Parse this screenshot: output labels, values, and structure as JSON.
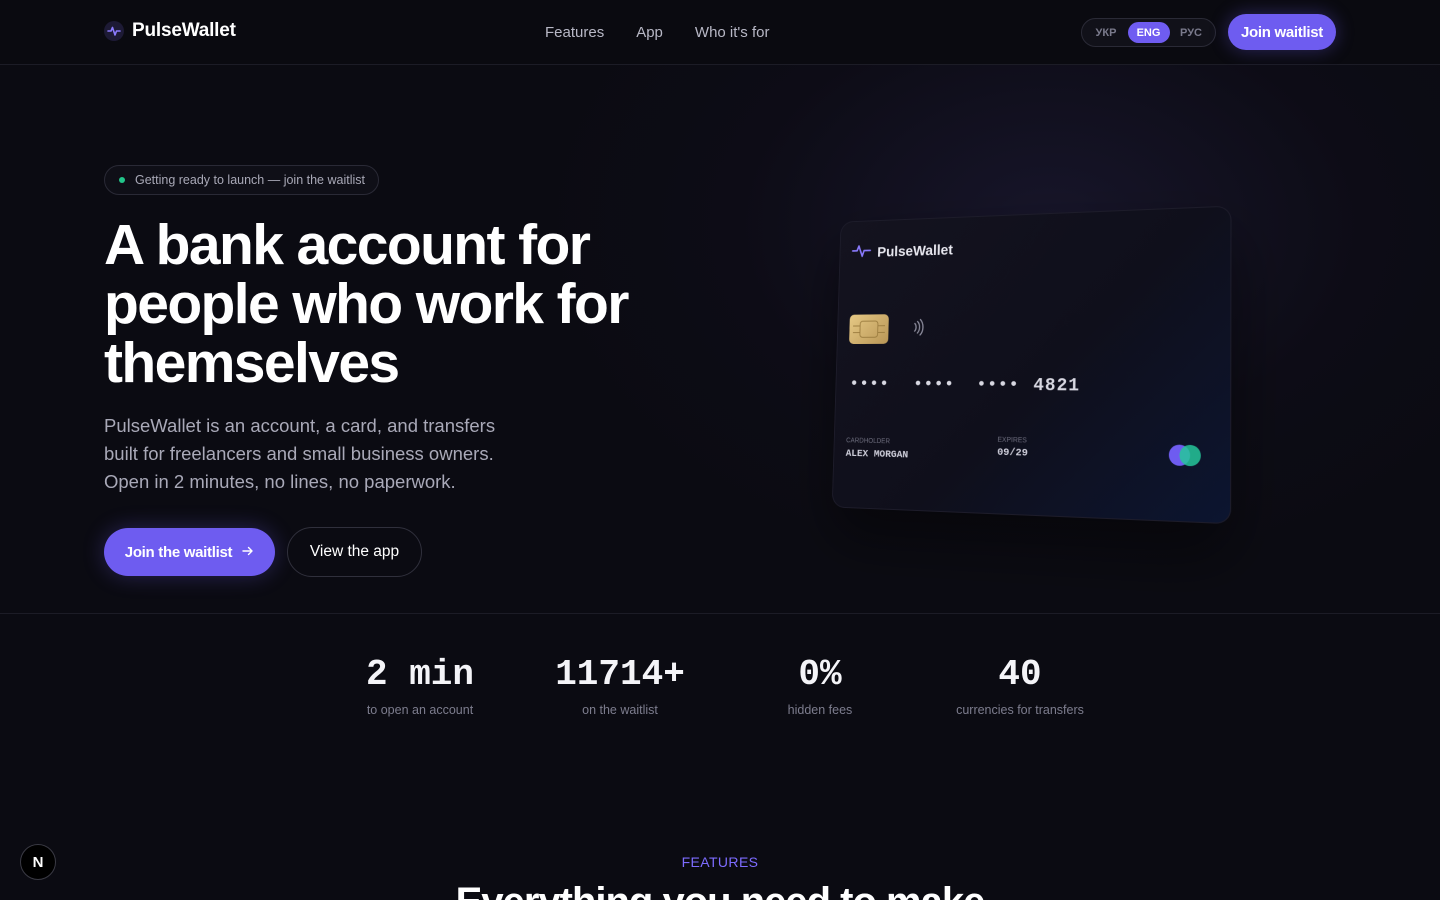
{
  "header": {
    "logo_text": "PulseWallet",
    "logo_icon": "pulse-icon",
    "nav": [
      "Features",
      "App",
      "Who it's for"
    ],
    "languages": [
      "УКР",
      "ENG",
      "РУС"
    ],
    "active_language": "ENG",
    "cta": "Join waitlist"
  },
  "hero": {
    "badge": "Getting ready to launch — join the waitlist",
    "headline": "A bank account for people who work for themselves",
    "subtext": "PulseWallet is an account, a card, and transfers built for freelancers and small business owners. Open in 2 minutes, no lines, no paperwork.",
    "primary_cta": "Join the waitlist",
    "primary_cta_icon": "arrow-right-icon",
    "secondary_cta": "View the app"
  },
  "card": {
    "brand": "PulseWallet",
    "number_groups": [
      "••••",
      "••••",
      "••••",
      "4821"
    ],
    "cardholder_label": "CARDHOLDER",
    "cardholder_name": "ALEX MORGAN",
    "expires_label": "EXPIRES",
    "expires_value": "09/29",
    "network_icon": "card-network-icon",
    "contactless_icon": "contactless-icon"
  },
  "stats": [
    {
      "value": "2 min",
      "label": "to open an account"
    },
    {
      "value": "11714+",
      "label": "on the waitlist"
    },
    {
      "value": "0%",
      "label": "hidden fees"
    },
    {
      "value": "40",
      "label": "currencies for transfers"
    }
  ],
  "features": {
    "eyebrow": "FEATURES",
    "title": "Everything you need to make"
  },
  "dev_badge": "N",
  "colors": {
    "accent": "#6e5cf0",
    "background": "#0b0b12",
    "status_dot": "#22c58a"
  }
}
